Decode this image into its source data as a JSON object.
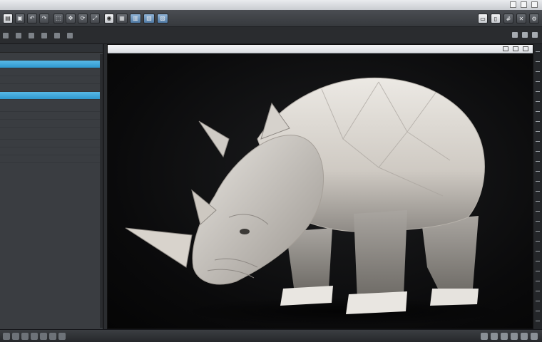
{
  "toolbar_main": {
    "icons": [
      "file-icon",
      "save-icon",
      "undo-icon",
      "redo-icon",
      "select-icon",
      "move-icon",
      "rotate-icon",
      "scale-icon",
      "render-icon",
      "camera-icon",
      "light-icon",
      "material-icon",
      "display-icon"
    ]
  },
  "toolbar_secondary": {
    "items": [
      "",
      "",
      "",
      "",
      "",
      "",
      "",
      ""
    ]
  },
  "outliner": {
    "header": "",
    "rows": [
      {
        "label": "",
        "value": "",
        "selected": false
      },
      {
        "label": "",
        "value": "",
        "selected": true
      },
      {
        "label": "",
        "value": "",
        "selected": false
      },
      {
        "label": "",
        "value": "",
        "selected": false
      },
      {
        "label": "",
        "value": "",
        "selected": false
      },
      {
        "label": "",
        "value": "",
        "selected": true
      },
      {
        "label": "",
        "value": "",
        "selected": false
      },
      {
        "label": "",
        "value": "",
        "selected": false
      },
      {
        "label": "",
        "value": "",
        "selected": false
      },
      {
        "label": "",
        "value": "",
        "selected": false
      },
      {
        "label": "",
        "value": "",
        "selected": false
      },
      {
        "label": "",
        "value": "",
        "selected": false
      },
      {
        "label": "",
        "value": "",
        "selected": false
      }
    ]
  },
  "viewport": {
    "tabs": [
      "",
      "",
      "",
      ""
    ],
    "subject": "rhinoceros 3D model"
  },
  "colors": {
    "selection": "#3aa6dc",
    "viewport_bg": "#0c0c0d",
    "model": "#d9d5cf"
  }
}
